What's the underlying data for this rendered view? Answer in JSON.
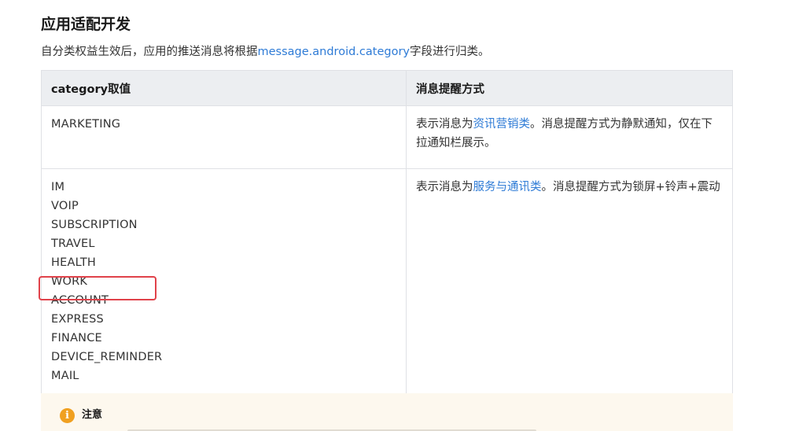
{
  "section": {
    "title": "应用适配开发",
    "intro_prefix": "自分类权益生效后，应用的推送消息将根据",
    "intro_link": "message.android.category",
    "intro_suffix": "字段进行归类。"
  },
  "table": {
    "headers": [
      "category取值",
      "消息提醒方式"
    ],
    "rows": [
      {
        "categories": [
          "MARKETING"
        ],
        "desc_prefix": "表示消息为",
        "desc_link": "资讯营销类",
        "desc_suffix": "。消息提醒方式为静默通知，仅在下拉通知栏展示。"
      },
      {
        "categories": [
          "IM",
          "VOIP",
          "SUBSCRIPTION",
          "TRAVEL",
          "HEALTH",
          "WORK",
          "ACCOUNT",
          "EXPRESS",
          "FINANCE",
          "DEVICE_REMINDER",
          "MAIL"
        ],
        "desc_prefix": "表示消息为",
        "desc_link": "服务与通讯类",
        "desc_suffix": "。消息提醒方式为锁屏+铃声+震动"
      }
    ]
  },
  "highlight": {
    "target": "ACCOUNT",
    "color": "#e0424a"
  },
  "notice": {
    "icon": "info-icon",
    "icon_glyph": "i",
    "title": "注意"
  },
  "colors": {
    "link": "#2e7bd6",
    "header_bg": "#eceef1",
    "notice_bg": "#fdf8ee",
    "notice_icon": "#f0a020"
  }
}
